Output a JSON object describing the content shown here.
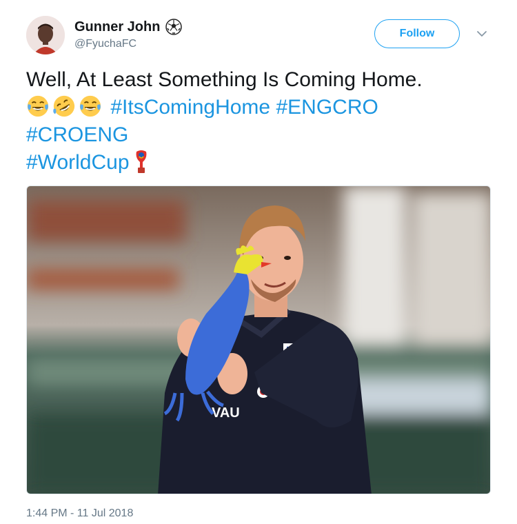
{
  "user": {
    "display_name": "Gunner John",
    "handle": "@FyuchaFC",
    "name_emoji": "soccer-ball-icon"
  },
  "actions": {
    "follow_label": "Follow",
    "menu_icon": "chevron-down-icon"
  },
  "tweet": {
    "text": "Well, At Least Something Is Coming Home.",
    "emojis": [
      "face-with-tears-of-joy",
      "rolling-on-the-floor-laughing",
      "face-with-tears-of-joy"
    ],
    "hashtags": [
      "#ItsComingHome",
      "#ENGCRO",
      "#CROENG",
      "#WorldCup"
    ],
    "trailing_emoji": "trophy-icon"
  },
  "media": {
    "jersey_text": "VAU"
  },
  "timestamp": "1:44 PM - 11 Jul 2018",
  "colors": {
    "accent": "#1da1f2",
    "hashtag": "#1b95e0",
    "secondary_text": "#657786"
  }
}
